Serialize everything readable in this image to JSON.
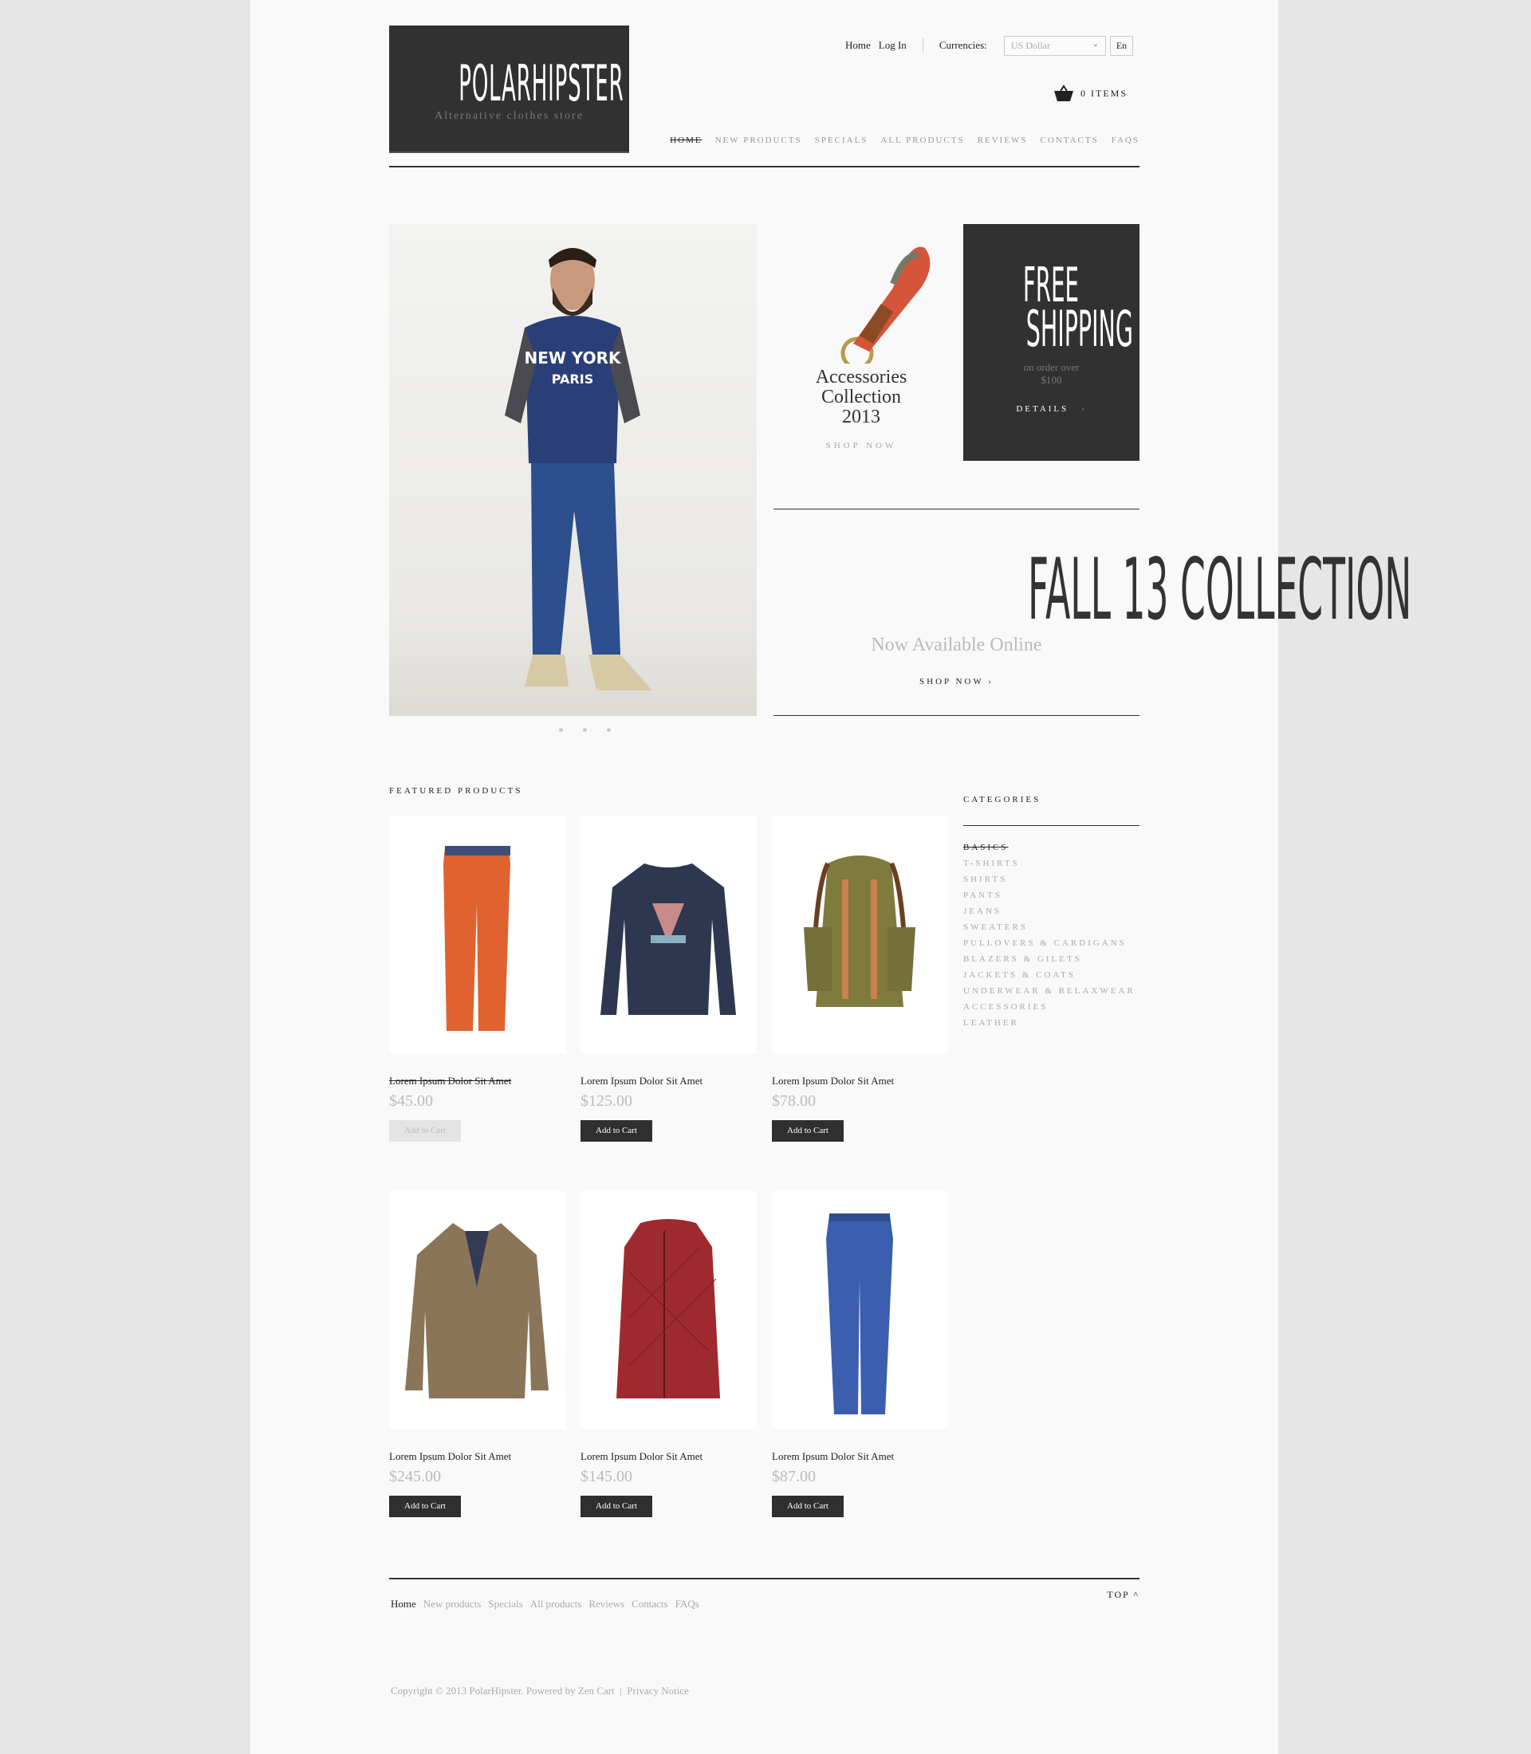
{
  "logo": {
    "title": "POLARHIPSTER",
    "tagline": "Alternative clothes store"
  },
  "top_links": {
    "home": "Home",
    "login": "Log In",
    "currencies_label": "Currencies:",
    "currency_value": "US Dollar",
    "language": "En"
  },
  "cart": {
    "icon": "basket-icon",
    "label": "0 ITEMS"
  },
  "nav": [
    "HOME",
    "NEW PRODUCTS",
    "SPECIALS",
    "ALL PRODUCTS",
    "REVIEWS",
    "CONTACTS",
    "FAQS"
  ],
  "banners": {
    "accessories": {
      "line1": "Accessories",
      "line2": "Collection",
      "line3": "2013",
      "cta": "SHOP NOW"
    },
    "shipping": {
      "line1": "FREE",
      "line2": "SHIPPING",
      "sub1": "on order over",
      "sub2": "$100",
      "cta": "DETAILS",
      "cta_icon": "›"
    },
    "fall": {
      "title": "FALL 13 COLLECTION",
      "subtitle": "Now Available Online",
      "cta": "SHOP NOW ›"
    }
  },
  "slider": {
    "dots": 3
  },
  "featured": {
    "title": "FEATURED PRODUCTS",
    "products": [
      {
        "name": "Lorem Ipsum Dolor Sit Amet",
        "price": "$45.00",
        "button": "Add to Cart",
        "image": "orange-pants",
        "disabled": true
      },
      {
        "name": "Lorem Ipsum Dolor Sit Amet",
        "price": "$125.00",
        "button": "Add to Cart",
        "image": "navy-sweatshirt"
      },
      {
        "name": "Lorem Ipsum Dolor Sit Amet",
        "price": "$78.00",
        "button": "Add to Cart",
        "image": "green-backpack"
      },
      {
        "name": "Lorem Ipsum Dolor Sit Amet",
        "price": "$245.00",
        "button": "Add to Cart",
        "image": "tweed-blazer"
      },
      {
        "name": "Lorem Ipsum Dolor Sit Amet",
        "price": "$145.00",
        "button": "Add to Cart",
        "image": "red-quilted-vest"
      },
      {
        "name": "Lorem Ipsum Dolor Sit Amet",
        "price": "$87.00",
        "button": "Add to Cart",
        "image": "blue-jeans"
      }
    ]
  },
  "categories": {
    "title": "CATEGORIES",
    "items": [
      "BASICS",
      "T-SHIRTS",
      "SHIRTS",
      "PANTS",
      "JEANS",
      "SWEATERS",
      "PULLOVERS & CARDIGANS",
      "BLAZERS & GILETS",
      "JACKETS & COATS",
      "UNDERWEAR & RELAXWEAR",
      "ACCESSORIES",
      "LEATHER"
    ]
  },
  "footer": {
    "links": [
      "Home",
      "New products",
      "Specials",
      "All products",
      "Reviews",
      "Contacts",
      "FAQs"
    ],
    "top": "TOP ^",
    "copyright": "Copyright © 2013 PolarHipster. Powered by Zen Cart  |  Privacy Notice"
  }
}
